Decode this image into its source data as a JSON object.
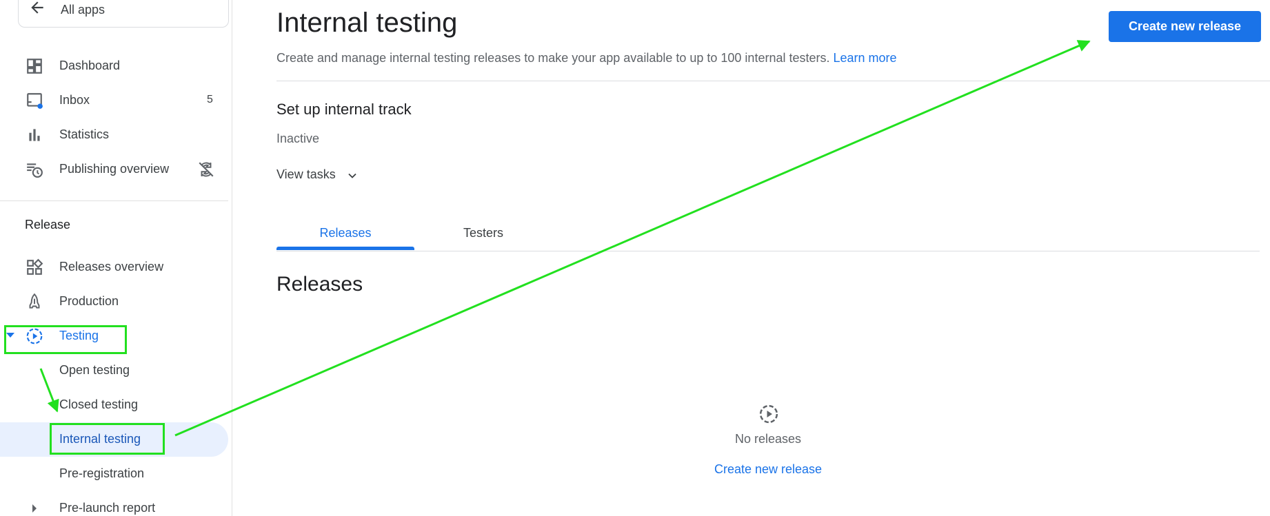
{
  "sidebar": {
    "back": {
      "label": "All apps",
      "icon": "arrow-back-icon"
    },
    "items": [
      {
        "label": "Dashboard",
        "icon": "dashboard-icon"
      },
      {
        "label": "Inbox",
        "icon": "inbox-icon",
        "badge": "5"
      },
      {
        "label": "Statistics",
        "icon": "bar-chart-icon"
      },
      {
        "label": "Publishing overview",
        "icon": "publishing-history-icon",
        "trail_icon": "sync-disabled-icon"
      }
    ],
    "release_section": {
      "title": "Release",
      "items": [
        {
          "label": "Releases overview",
          "icon": "releases-overview-icon"
        },
        {
          "label": "Production",
          "icon": "rocket-icon"
        },
        {
          "label": "Testing",
          "icon": "testing-icon",
          "expanded": true
        },
        {
          "label": "Open testing"
        },
        {
          "label": "Closed testing"
        },
        {
          "label": "Internal testing",
          "selected": true
        },
        {
          "label": "Pre-registration"
        },
        {
          "label": "Pre-launch report",
          "collapsed": true
        }
      ]
    }
  },
  "header": {
    "title": "Internal testing",
    "description": "Create and manage internal testing releases to make your app available to up to 100 internal testers.",
    "learn_more": "Learn more",
    "create_button": "Create new release"
  },
  "track": {
    "title": "Set up internal track",
    "status": "Inactive",
    "view_tasks": "View tasks"
  },
  "tabs": [
    {
      "label": "Releases",
      "active": true
    },
    {
      "label": "Testers",
      "active": false
    }
  ],
  "releases": {
    "heading": "Releases",
    "empty_text": "No releases",
    "empty_icon": "play-circle-dashed-icon",
    "empty_link": "Create new release"
  },
  "colors": {
    "accent": "#1a73e8",
    "annotation": "#22e01f",
    "selected_bg": "#e8f0fe"
  }
}
